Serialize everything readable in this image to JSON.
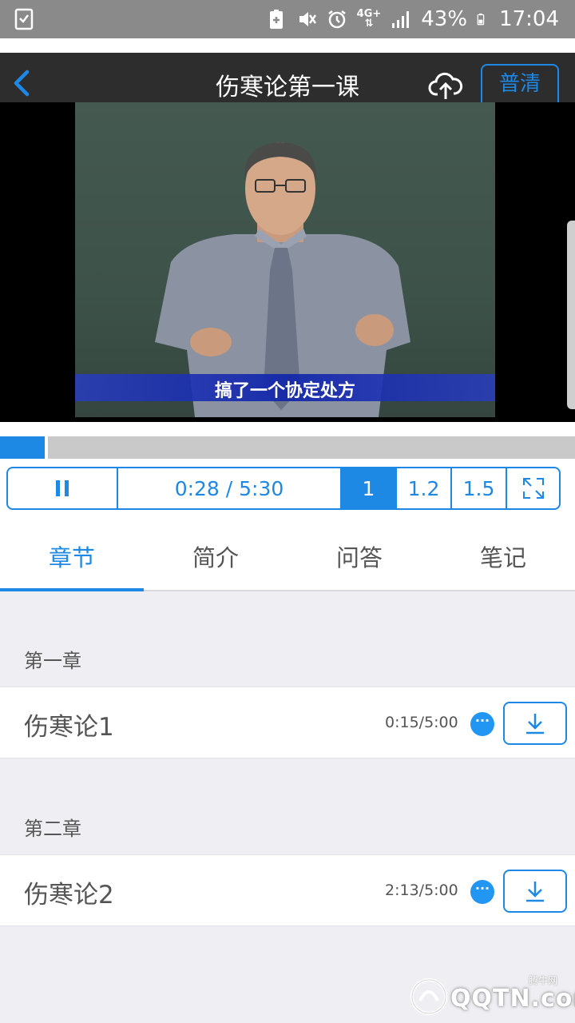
{
  "status_bar": {
    "battery_percent": "43%",
    "time": "17:04",
    "network": "4G+"
  },
  "header": {
    "title": "伤寒论第一课",
    "quality_label": "普清"
  },
  "video": {
    "subtitle": "搞了一个协定处方"
  },
  "player": {
    "progress_fraction": 0.085,
    "time_display": "0:28 / 5:30",
    "speeds": [
      "1",
      "1.2",
      "1.5"
    ],
    "active_speed": "1"
  },
  "tabs": [
    {
      "label": "章节",
      "active": true
    },
    {
      "label": "简介",
      "active": false
    },
    {
      "label": "问答",
      "active": false
    },
    {
      "label": "笔记",
      "active": false
    }
  ],
  "chapters": [
    {
      "title": "第一章",
      "lessons": [
        {
          "title": "伤寒论1",
          "progress": "0:15/5:00"
        }
      ]
    },
    {
      "title": "第二章",
      "lessons": [
        {
          "title": "伤寒论2",
          "progress": "2:13/5:00"
        }
      ]
    }
  ],
  "more_label": "···",
  "watermark": {
    "text": "QQTN.com",
    "small": "腾牛网"
  },
  "colors": {
    "accent": "#1e88e5",
    "title_bar": "#2d2d2d",
    "status_bar": "#8a8a8a",
    "list_bg": "#eeeef3"
  }
}
